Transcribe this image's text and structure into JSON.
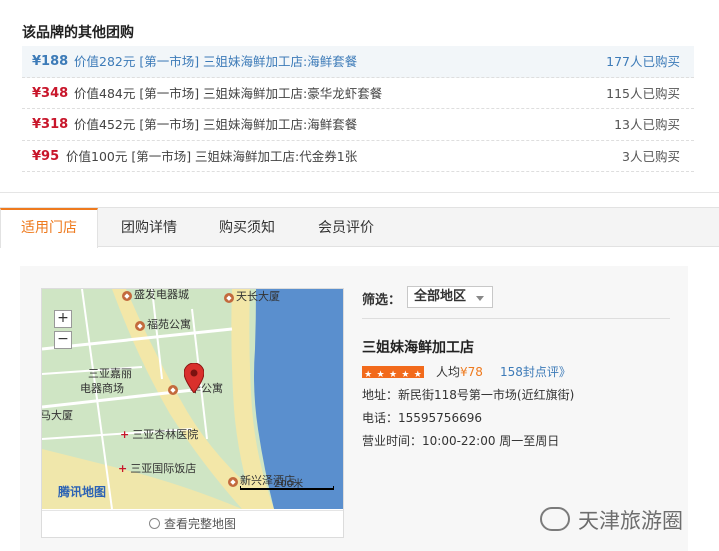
{
  "other_deals": {
    "title": "该品牌的其他团购",
    "items": [
      {
        "price": "¥188",
        "desc": "价值282元 [第一市场] 三姐妹海鲜加工店:海鲜套餐",
        "count": "177人已购买"
      },
      {
        "price": "¥348",
        "desc": "价值484元 [第一市场] 三姐妹海鲜加工店:豪华龙虾套餐",
        "count": "115人已购买"
      },
      {
        "price": "¥318",
        "desc": "价值452元 [第一市场] 三姐妹海鲜加工店:海鲜套餐",
        "count": "13人已购买"
      },
      {
        "price": "¥95",
        "desc": "价值100元 [第一市场] 三姐妹海鲜加工店:代金券1张",
        "count": "3人已购买"
      }
    ]
  },
  "tabs": [
    "适用门店",
    "团购详情",
    "购买须知",
    "会员评价"
  ],
  "map": {
    "labels": {
      "dianqi": "盛发电器城",
      "changtian": "天长大厦",
      "fuyuan": "福苑公寓",
      "jiali_1": "三亚嘉丽",
      "jiali_2": "电器商场",
      "huagongyu": "华公寓",
      "mashang": "马大厦",
      "xinglin": "三亚杏林医院",
      "guoji": "三亚国际饭店",
      "xinxing": "新兴泽酒店"
    },
    "zoom_in": "+",
    "zoom_out": "−",
    "logo": "腾讯地图",
    "scale": "200米",
    "view_full": "查看完整地图"
  },
  "filter": {
    "label": "筛选：",
    "selected": "全部地区"
  },
  "store": {
    "name": "三姐妹海鲜加工店",
    "avg_label": "人均",
    "avg_price": "¥78",
    "reviews": "158封点评》",
    "address": "地址：新民街118号第一市场(近红旗街)",
    "phone": "电话：15595756696",
    "hours": "营业时间：10:00-22:00 周一至周日"
  },
  "watermark": "天津旅游圈",
  "colors": {
    "price_red": "#c8162b",
    "link_blue": "#3d7bb8",
    "tab_orange": "#ee7a1e",
    "star_orange": "#f26a1b",
    "sea_blue": "#5a8fce",
    "map_green": "#cfe5c4"
  }
}
